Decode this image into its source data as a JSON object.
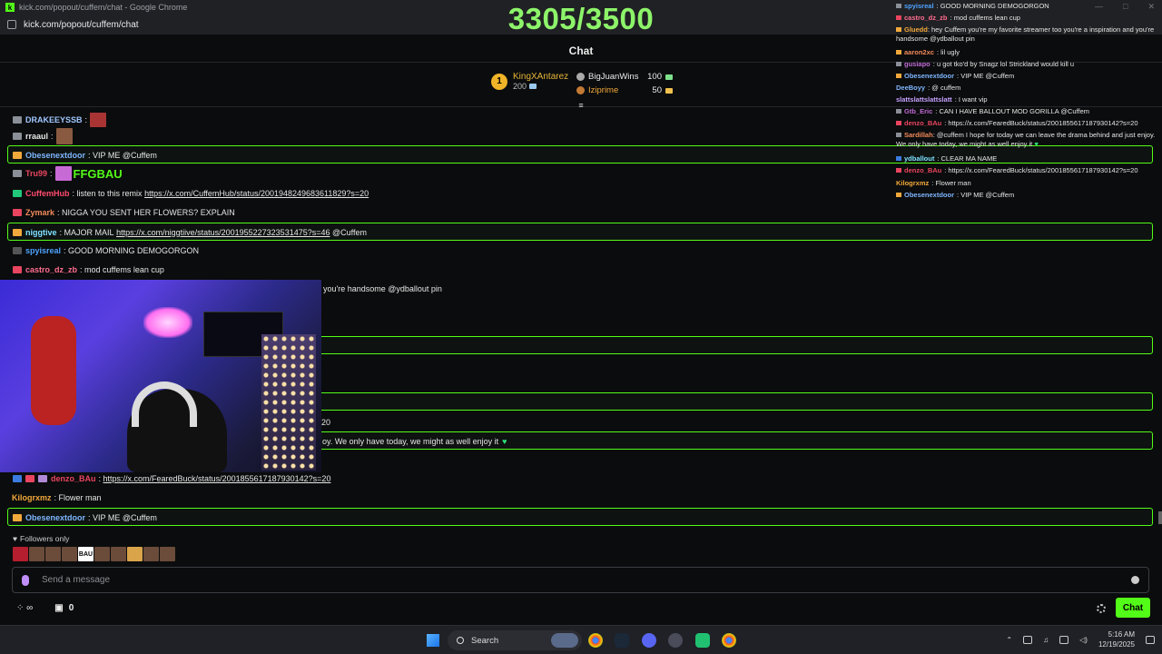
{
  "browser": {
    "title": "kick.com/popout/cuffem/chat - Google Chrome",
    "url": "kick.com/popout/cuffem/chat"
  },
  "counter": "3305/3500",
  "header": {
    "title": "Chat"
  },
  "leaderboard": {
    "first": {
      "rank": "1",
      "name": "KingXAntarez",
      "value": "200"
    },
    "others": [
      {
        "name": "BigJuanWins",
        "value": "100"
      },
      {
        "name": "Iziprime",
        "value": "50"
      }
    ]
  },
  "messages": [
    {
      "user": "DRAKEEYSSB",
      "color": "#9fc7ff",
      "text": ""
    },
    {
      "user": "rraaul",
      "color": "#e8e8e8",
      "text": ""
    },
    {
      "user": "Obesenextdoor",
      "color": "#7fb6ff",
      "text": "VIP ME @Cuffem"
    },
    {
      "user": "Tru99",
      "color": "#e94560",
      "text": ""
    },
    {
      "user": "CuffemHub",
      "color": "#ff4b6e",
      "text": "listen to this remix",
      "link": "https://x.com/CuffemHub/status/2001948249683611829?s=20"
    },
    {
      "user": "Zymark",
      "color": "#f28a5c",
      "text": "NIGGA YOU SENT HER FLOWERS? EXPLAIN"
    },
    {
      "user": "niggtive",
      "color": "#7fe0ff",
      "text": "MAJOR MAIL",
      "link": "https://x.com/niggtiive/status/2001955227323531475?s=46",
      "tail": "@Cuffem"
    },
    {
      "user": "spyisreal",
      "color": "#4fa3ff",
      "text": "GOOD MORNING DEMOGORGON"
    },
    {
      "user": "castro_dz_zb",
      "color": "#ff6d8f",
      "text": "mod cuffems lean cup"
    },
    {
      "fragment": "you're handsome @ydballout pin"
    },
    {
      "fragment": "20"
    },
    {
      "fragment": "oy. We only have today, we might as well enjoy it"
    },
    {
      "user": "denzo_BAu",
      "color": "#e94560",
      "link": "https://x.com/FearedBuck/status/2001855617187930142?s=20"
    },
    {
      "user": "Kilogrxmz",
      "color": "#f2a93b",
      "text": "Flower man"
    },
    {
      "user": "Obesenextdoor",
      "color": "#7fb6ff",
      "text": "VIP ME @Cuffem"
    }
  ],
  "emotes_text": {
    "ffgbau": "FFGBAU",
    "bau": "BAU"
  },
  "followers_only": "Followers only",
  "input": {
    "placeholder": "Send a message"
  },
  "points": "0",
  "chat_button": "Chat",
  "overlay_messages": [
    {
      "user": "spyisreal",
      "color": "#4fa3ff",
      "text": "GOOD MORNING DEMOGORGON"
    },
    {
      "user": "castro_dz_zb",
      "color": "#ff6d8f",
      "text": "mod cuffems lean cup"
    },
    {
      "user": "Gluedd",
      "color": "#f2a93b",
      "text": "hey Cuffem you're my favorite streamer too you're a inspiration and you're handsome @ydballout pin"
    },
    {
      "user": "aaron2xc",
      "color": "#f28a5c",
      "text": "lil ugly"
    },
    {
      "user": "gusiapo",
      "color": "#c06bd6",
      "text": "u got tko'd by Snagz lol Strickland would kill u"
    },
    {
      "user": "Obesenextdoor",
      "color": "#7fb6ff",
      "text": "VIP ME @Cuffem"
    },
    {
      "user": "DeeBoyy",
      "color": "#7fb6ff",
      "text": "@ cuffem"
    },
    {
      "user": "slattslattslattslatt",
      "color": "#c6a0ff",
      "text": "I want vip"
    },
    {
      "user": "Gtb_Eric",
      "color": "#c06bd6",
      "text": "CAN I HAVE BALLOUT MOD GORILLA @Cuffem"
    },
    {
      "user": "denzo_BAu",
      "color": "#e94560",
      "text": "https://x.com/FearedBuck/status/2001855617187930142?s=20"
    },
    {
      "user": "Sardillah",
      "color": "#f28a5c",
      "text": "@cuffem I hope for today we can leave the drama behind and just enjoy. We only have today, we might as well enjoy it"
    },
    {
      "user": "ydballout",
      "color": "#7fe0ff",
      "text": "CLEAR MA NAME"
    },
    {
      "user": "denzo_BAu",
      "color": "#e94560",
      "text": "https://x.com/FearedBuck/status/2001855617187930142?s=20"
    },
    {
      "user": "Kilogrxmz",
      "color": "#f2a93b",
      "text": "Flower man"
    },
    {
      "user": "Obesenextdoor",
      "color": "#7fb6ff",
      "text": "VIP ME @Cuffem"
    }
  ],
  "taskbar": {
    "search": "Search",
    "time": "5:16 AM",
    "date": "12/19/2025"
  }
}
